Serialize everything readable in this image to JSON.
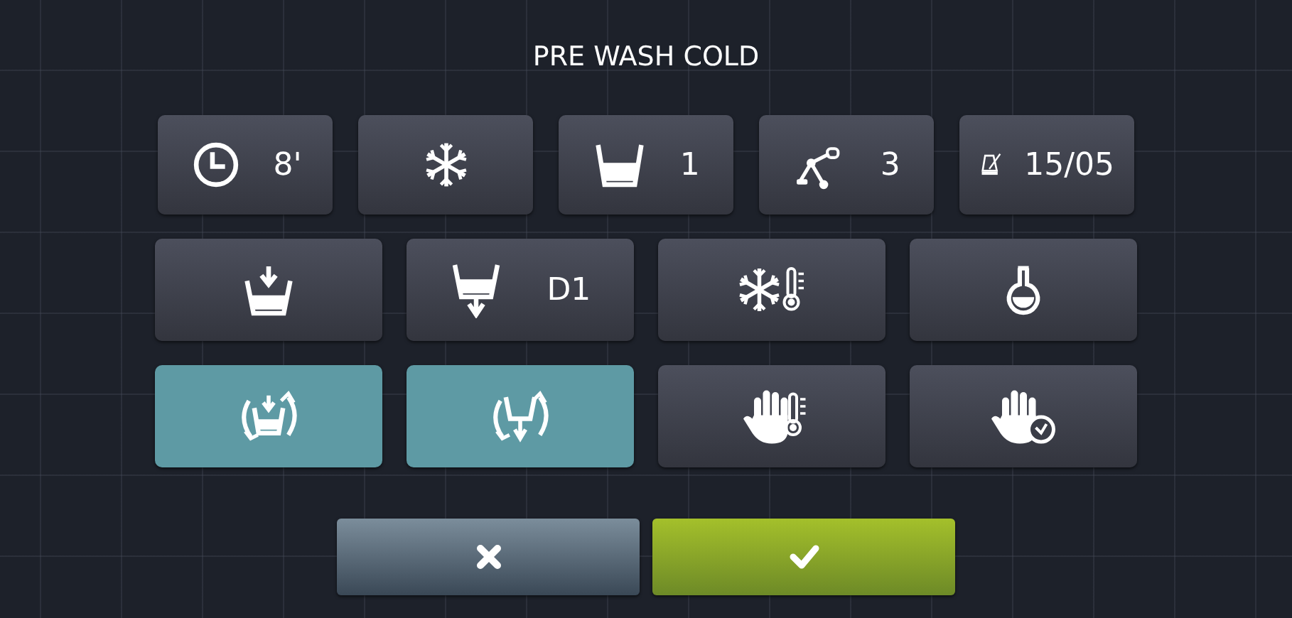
{
  "title": "PRE WASH COLD",
  "rows": [
    {
      "buttons": [
        {
          "kind": "clock",
          "value": "8'",
          "selected": false
        },
        {
          "kind": "snowflake",
          "selected": false
        },
        {
          "kind": "basin",
          "value": "1",
          "selected": false
        },
        {
          "kind": "arm",
          "value": "3",
          "selected": false
        },
        {
          "kind": "metronome",
          "value": "15/05",
          "selected": false
        }
      ]
    },
    {
      "buttons": [
        {
          "kind": "fill",
          "selected": false
        },
        {
          "kind": "drain",
          "value": "D1",
          "selected": false
        },
        {
          "kind": "cold-temp",
          "selected": false
        },
        {
          "kind": "flask",
          "selected": false
        }
      ]
    },
    {
      "buttons": [
        {
          "kind": "fill-cycle",
          "selected": true
        },
        {
          "kind": "drain-cycle",
          "selected": true
        },
        {
          "kind": "hand-temp",
          "selected": false
        },
        {
          "kind": "hand-time",
          "selected": false
        }
      ]
    }
  ],
  "actions": [
    {
      "kind": "cancel"
    },
    {
      "kind": "confirm"
    }
  ]
}
